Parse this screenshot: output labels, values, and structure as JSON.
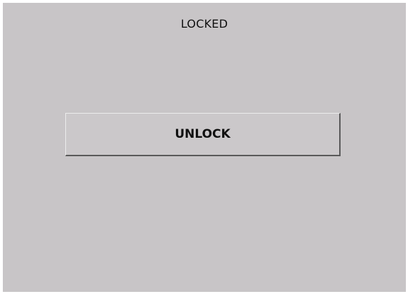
{
  "status": {
    "label": "LOCKED"
  },
  "actions": {
    "unlock_label": "UNLOCK"
  },
  "colors": {
    "background": "#c8c5c7",
    "button_face": "#cbc8ca",
    "text": "#111111"
  }
}
